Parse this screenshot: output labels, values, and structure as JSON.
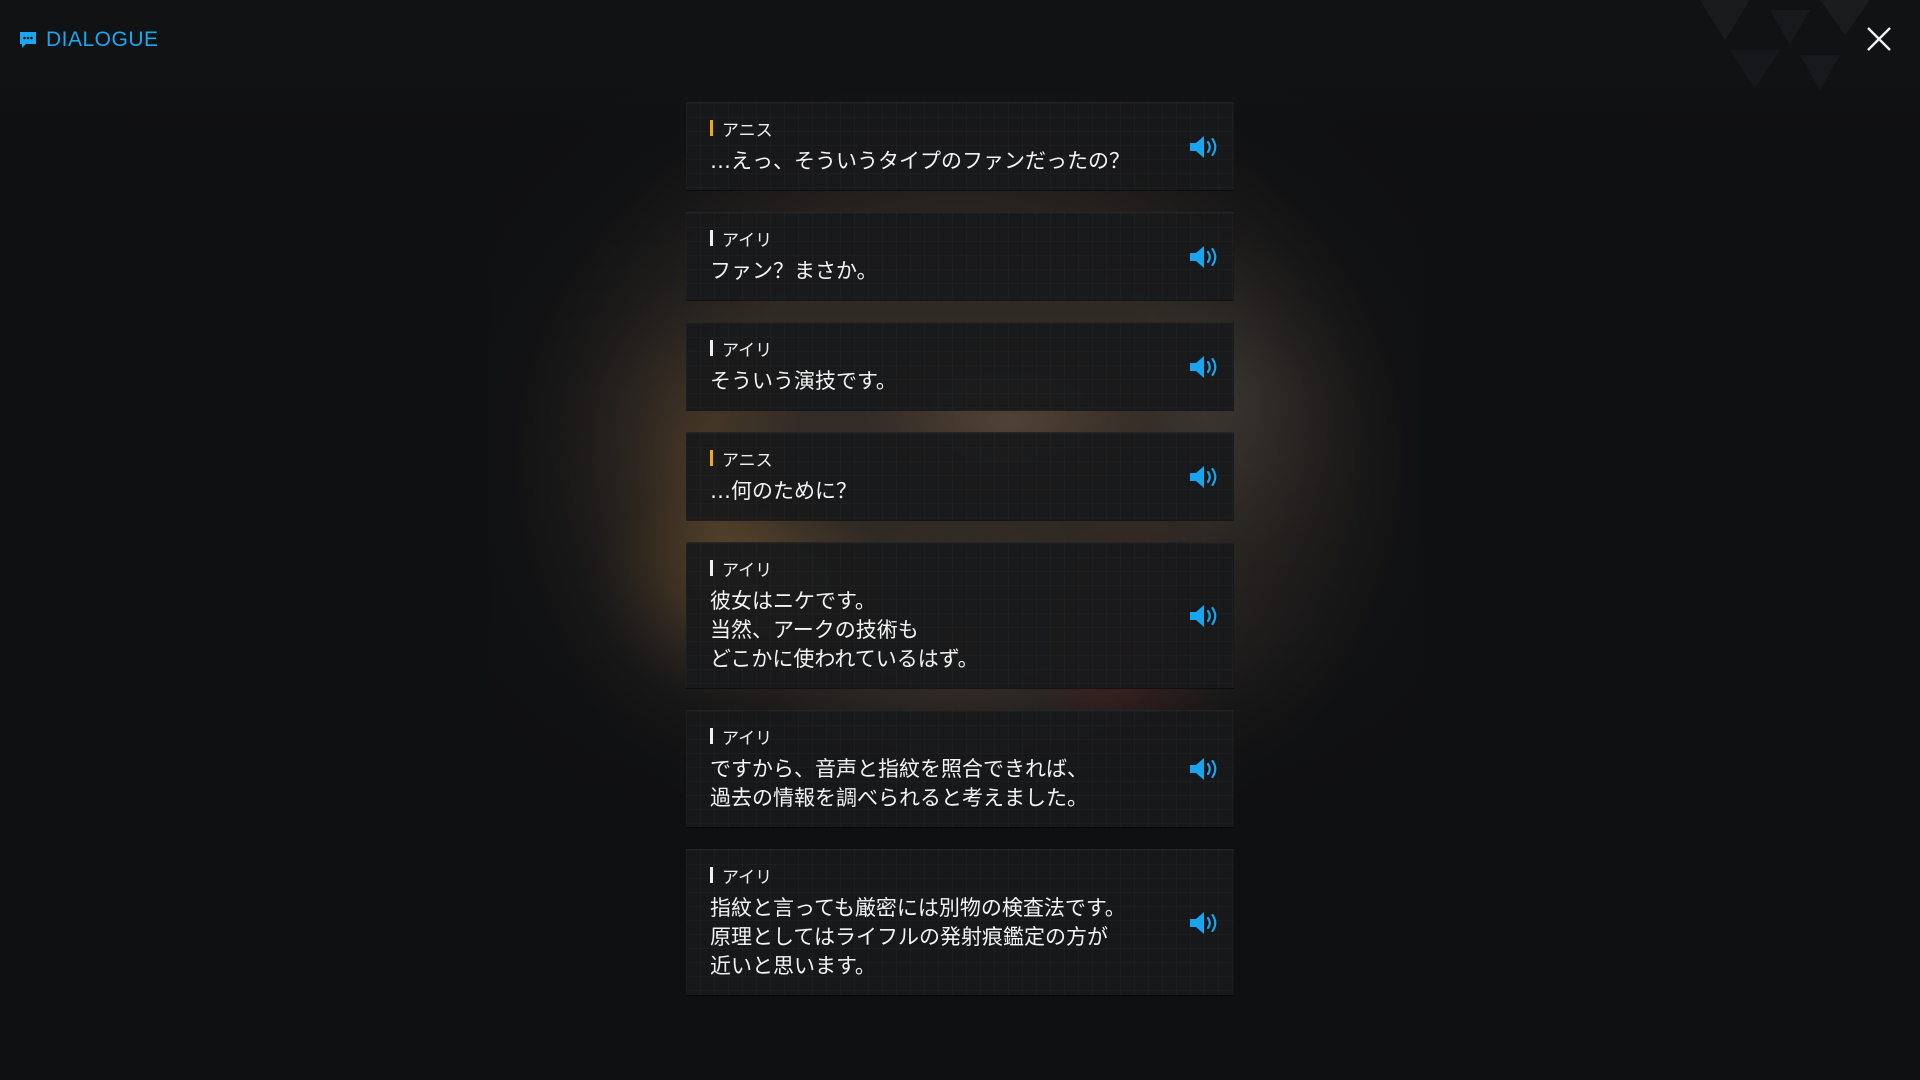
{
  "header": {
    "title": "DIALOGUE",
    "icon": "chat-bubble-icon",
    "accent_color": "#19a7f2"
  },
  "close": {
    "icon": "close-icon"
  },
  "entries": [
    {
      "speaker": "アニス",
      "marker_color": "#f2a81d",
      "text": "…えっ、そういうタイプのファンだったの？"
    },
    {
      "speaker": "アイリ",
      "marker_color": "#f0f0f0",
      "text": "ファン？まさか。"
    },
    {
      "speaker": "アイリ",
      "marker_color": "#f0f0f0",
      "text": "そういう演技です。"
    },
    {
      "speaker": "アニス",
      "marker_color": "#f2a81d",
      "text": "…何のために？"
    },
    {
      "speaker": "アイリ",
      "marker_color": "#f0f0f0",
      "text": "彼女はニケです。\n当然、アークの技術も\nどこかに使われているはず。"
    },
    {
      "speaker": "アイリ",
      "marker_color": "#f0f0f0",
      "text": "ですから、音声と指紋を照合できれば、\n過去の情報を調べられると考えました。"
    },
    {
      "speaker": "アイリ",
      "marker_color": "#f0f0f0",
      "text": "指紋と言っても厳密には別物の検査法です。\n原理としてはライフルの発射痕鑑定の方が\n近いと思います。"
    }
  ],
  "voice_icon": "speaker-volume-icon"
}
